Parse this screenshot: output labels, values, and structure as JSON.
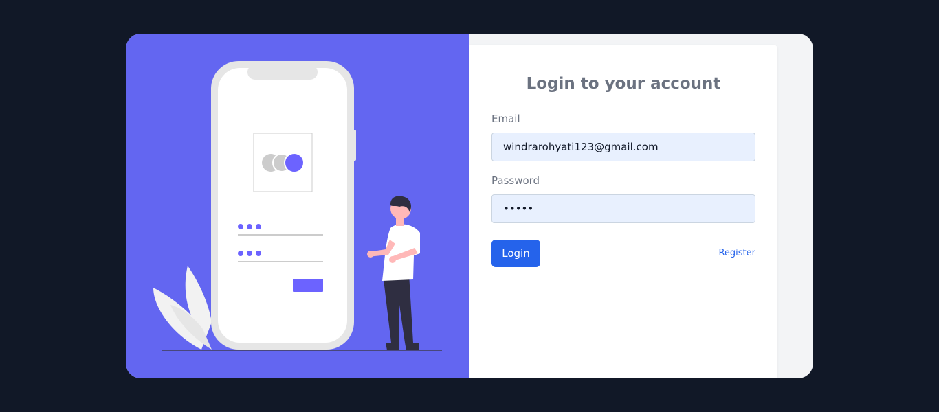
{
  "form": {
    "title": "Login to your account",
    "email_label": "Email",
    "email_value": "windrarohyati123@gmail.com",
    "password_label": "Password",
    "password_value": "windr",
    "login_label": "Login",
    "register_label": "Register"
  },
  "colors": {
    "page_background": "#111827",
    "illustration_background": "#6366f1",
    "accent": "#2563eb",
    "input_background": "#e8f0fe",
    "title_text": "#6b7280"
  },
  "illustration": {
    "icon": "login-illustration-icon"
  }
}
